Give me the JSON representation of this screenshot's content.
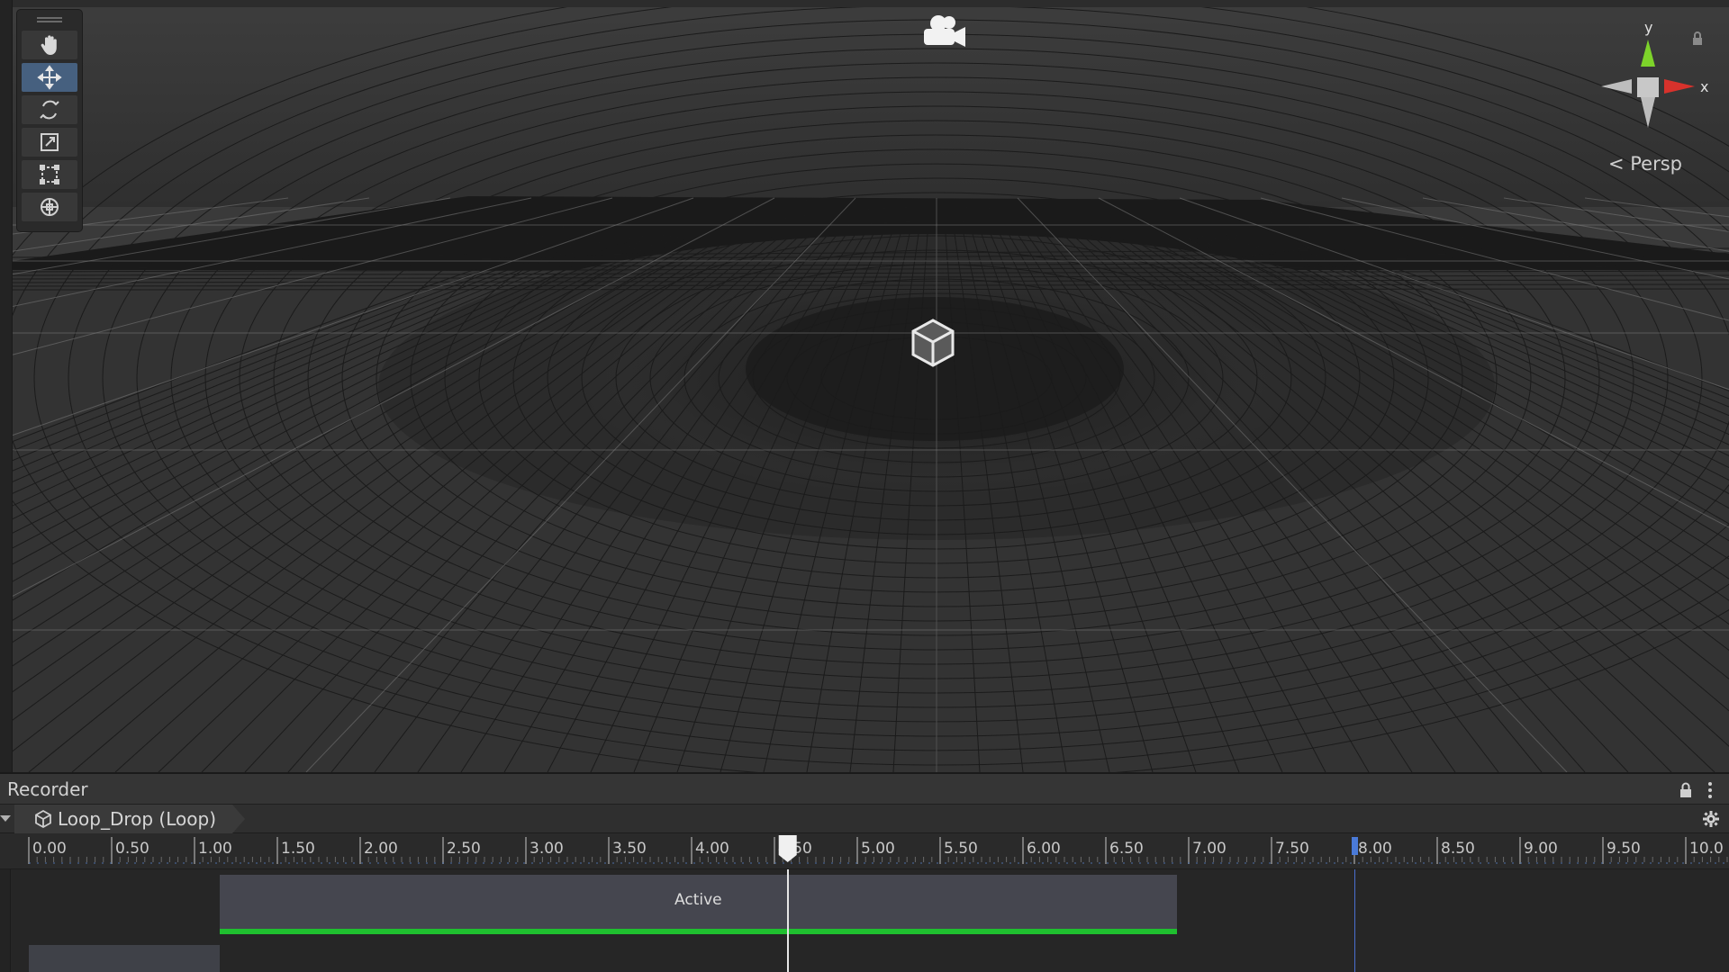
{
  "scene": {
    "camera_icon": "camera-icon",
    "gizmo": {
      "y_label": "y",
      "x_label": "x",
      "projection_label": "< Persp",
      "colors": {
        "y": "#7dd32a",
        "x": "#d8322c",
        "neutral": "#bdbdbd"
      }
    },
    "selected_object_icon": "cube-wireframe-icon"
  },
  "toolbar": {
    "tools": [
      {
        "name": "hand-tool",
        "icon": "hand-icon",
        "active": false
      },
      {
        "name": "move-tool",
        "icon": "move-arrows-icon",
        "active": true
      },
      {
        "name": "rotate-tool",
        "icon": "rotate-icon",
        "active": false
      },
      {
        "name": "scale-tool",
        "icon": "scale-icon",
        "active": false
      },
      {
        "name": "rect-tool",
        "icon": "rect-transform-icon",
        "active": false
      },
      {
        "name": "transform-tool",
        "icon": "transform-all-icon",
        "active": false
      }
    ],
    "active_color": "#46607f"
  },
  "recorder": {
    "title": "Recorder",
    "breadcrumb": {
      "label": "Loop_Drop (Loop)",
      "icon": "prefab-cube-icon"
    },
    "ruler": {
      "labels": [
        "0.00",
        "0.50",
        "1.00",
        "1.50",
        "2.00",
        "2.50",
        "3.00",
        "3.50",
        "4.00",
        "4.50",
        "5.00",
        "5.50",
        "6.00",
        "6.50",
        "7.00",
        "7.50",
        "8.00",
        "8.50",
        "9.00",
        "9.50",
        "10.0"
      ],
      "start": 0.0,
      "step": 0.5
    },
    "playhead_time": 4.58,
    "marker_time": 8.0,
    "clip": {
      "label": "Active",
      "start": 1.15,
      "end": 6.93,
      "color": "#45464f",
      "bar_color": "#1fbf2f"
    },
    "lower_clip": {
      "start": 0.0,
      "end": 1.15
    }
  }
}
